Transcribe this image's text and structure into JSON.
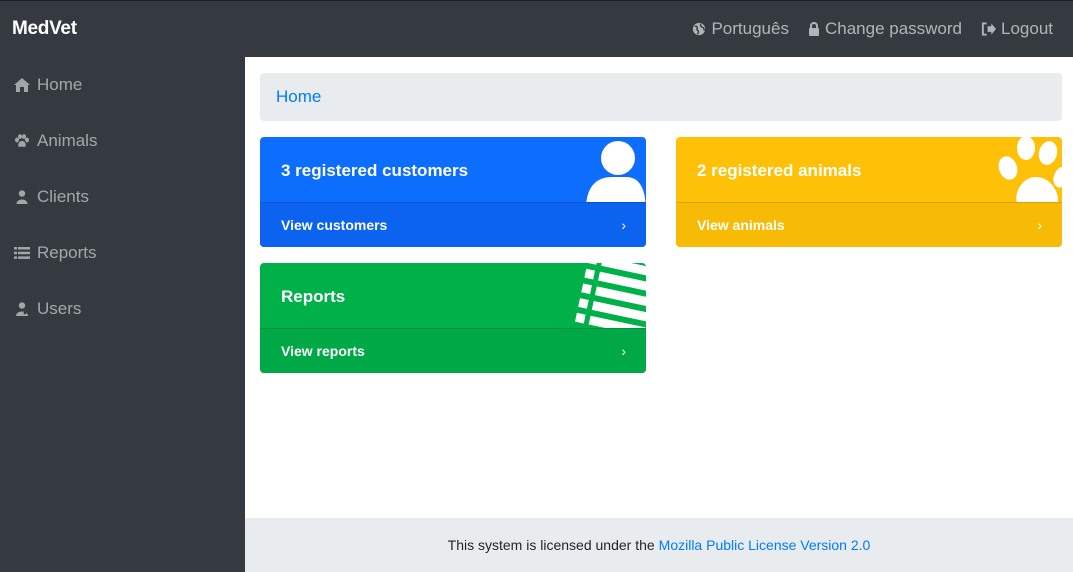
{
  "app": {
    "brand": "MedVet"
  },
  "navbar": {
    "language": "Português",
    "change_password": "Change password",
    "logout": "Logout"
  },
  "sidebar": {
    "items": [
      {
        "label": "Home",
        "icon": "home-icon"
      },
      {
        "label": "Animals",
        "icon": "paw-icon"
      },
      {
        "label": "Clients",
        "icon": "user-icon"
      },
      {
        "label": "Reports",
        "icon": "list-icon"
      },
      {
        "label": "Users",
        "icon": "user-md-icon"
      }
    ]
  },
  "breadcrumb": {
    "home": "Home"
  },
  "cards": {
    "customers": {
      "title": "3 registered customers",
      "link": "View customers",
      "color": "#0d6efd"
    },
    "animals": {
      "title": "2 registered animals",
      "link": "View animals",
      "color": "#ffc107"
    },
    "reports": {
      "title": "Reports",
      "link": "View reports",
      "color": "#00b14a"
    }
  },
  "footer": {
    "text": "This system is licensed under the",
    "link": "Mozilla Public License Version 2.0"
  },
  "colors": {
    "navbar_bg": "#343a40",
    "link": "#007bff",
    "breadcrumb_bg": "#e9ecef"
  }
}
